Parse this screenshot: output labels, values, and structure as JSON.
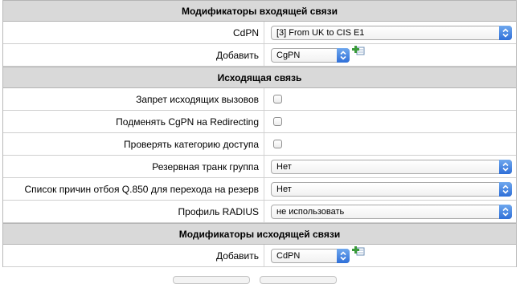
{
  "incoming_modifiers": {
    "title": "Модификаторы входящей связи",
    "cdpn_label": "CdPN",
    "cdpn_value": "[3] From UK to CIS E1",
    "add_label": "Добавить",
    "add_value": "CgPN"
  },
  "outgoing": {
    "title": "Исходящая связь",
    "rows": [
      {
        "label": "Запрет исходящих вызовов",
        "checked": false
      },
      {
        "label": "Подменять CgPN на Redirecting",
        "checked": false
      },
      {
        "label": "Проверять категорию доступа",
        "checked": false
      }
    ],
    "backup_trunk_label": "Резервная транк группа",
    "backup_trunk_value": "Нет",
    "q850_label": "Список причин отбоя Q.850 для перехода на резерв",
    "q850_value": "Нет",
    "radius_label": "Профиль RADIUS",
    "radius_value": "не использовать"
  },
  "outgoing_modifiers": {
    "title": "Модификаторы исходящей связи",
    "add_label": "Добавить",
    "add_value": "CdPN"
  },
  "colors": {
    "header_bg": "#d9d9d9",
    "select_arrow": "#2f6fd8",
    "add_icon": "#3a9a3a"
  },
  "icons": {
    "select_arrow": "chevron-updown-icon",
    "add": "add-plus-icon"
  }
}
